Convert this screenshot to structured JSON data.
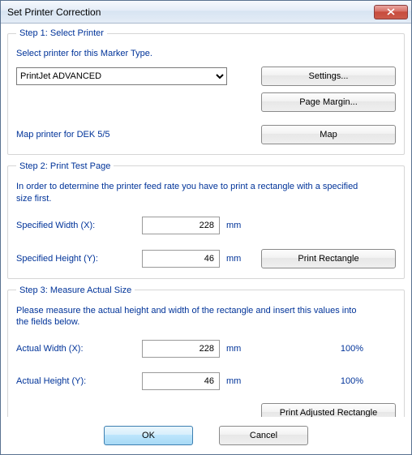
{
  "window": {
    "title": "Set Printer Correction"
  },
  "step1": {
    "legend": "Step 1: Select Printer",
    "instruction": "Select printer for this Marker Type.",
    "printer_selected": "PrintJet ADVANCED",
    "settings_btn": "Settings...",
    "page_margin_btn": "Page Margin...",
    "map_label": "Map printer for DEK 5/5",
    "map_btn": "Map"
  },
  "step2": {
    "legend": "Step 2: Print Test Page",
    "instruction": "In order to determine the printer feed rate you have to print a rectangle with a specified size first.",
    "width_label": "Specified Width (X):",
    "width_value": "228",
    "height_label": "Specified Height (Y):",
    "height_value": "46",
    "unit": "mm",
    "print_btn": "Print Rectangle"
  },
  "step3": {
    "legend": "Step 3: Measure Actual Size",
    "instruction": "Please measure the actual height and width of the rectangle and insert this values into the fields below.",
    "width_label": "Actual Width (X):",
    "width_value": "228",
    "width_percent": "100%",
    "height_label": "Actual Height (Y):",
    "height_value": "46",
    "height_percent": "100%",
    "unit": "mm",
    "print_btn": "Print Adjusted Rectangle"
  },
  "footer": {
    "ok": "OK",
    "cancel": "Cancel"
  }
}
